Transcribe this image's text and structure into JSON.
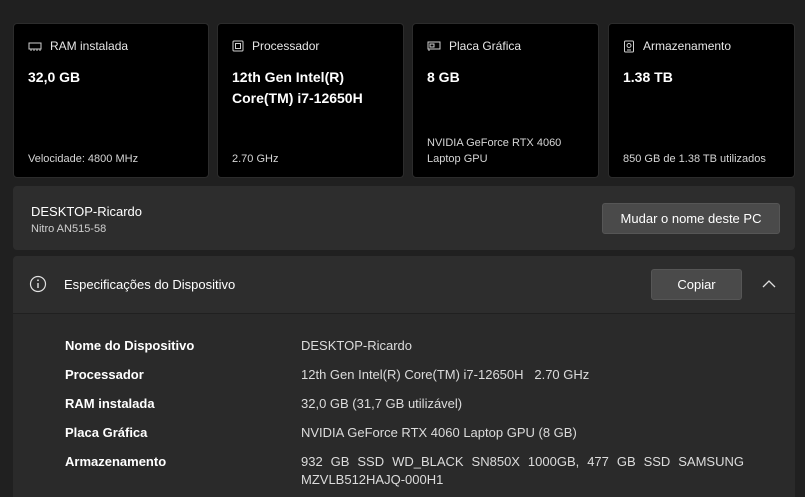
{
  "cards": [
    {
      "icon": "ram-icon",
      "label": "RAM instalada",
      "value": "32,0 GB",
      "sub": "Velocidade: 4800 MHz"
    },
    {
      "icon": "processor-icon",
      "label": "Processador",
      "value": "12th Gen Intel(R) Core(TM) i7-12650H",
      "sub": "2.70 GHz"
    },
    {
      "icon": "gpu-icon",
      "label": "Placa Gráfica",
      "value": "8 GB",
      "sub": "NVIDIA GeForce RTX 4060 Laptop GPU"
    },
    {
      "icon": "storage-icon",
      "label": "Armazenamento",
      "value": "1.38 TB",
      "sub": "850 GB de 1.38 TB utilizados"
    }
  ],
  "device": {
    "name": "DESKTOP-Ricardo",
    "model": "Nitro AN515-58",
    "rename_label": "Mudar o nome deste PC"
  },
  "specs": {
    "title": "Especificações do Dispositivo",
    "copy_label": "Copiar",
    "rows": [
      {
        "label": "Nome do Dispositivo",
        "value": "DESKTOP-Ricardo"
      },
      {
        "label": "Processador",
        "value": "12th Gen Intel(R) Core(TM) i7-12650H   2.70 GHz"
      },
      {
        "label": "RAM instalada",
        "value": "32,0 GB (31,7 GB utilizável)"
      },
      {
        "label": "Placa Gráfica",
        "value": "NVIDIA GeForce RTX 4060 Laptop GPU (8 GB)"
      },
      {
        "label": "Armazenamento",
        "value": "932 GB SSD WD_BLACK SN850X 1000GB, 477 GB SSD SAMSUNG MZVLB512HAJQ-000H1"
      }
    ]
  }
}
